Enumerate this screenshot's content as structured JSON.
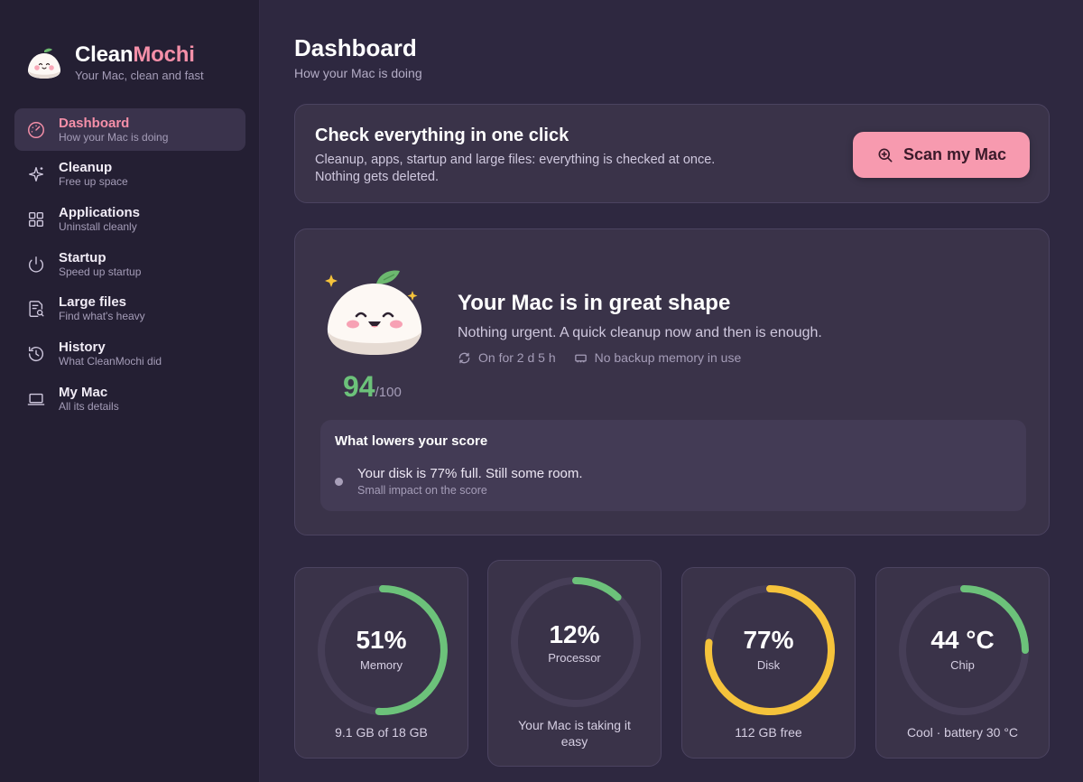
{
  "brand": {
    "name_part1": "Clean",
    "name_part2": "Mochi",
    "tagline": "Your Mac, clean and fast"
  },
  "nav": [
    {
      "label": "Dashboard",
      "sub": "How your Mac is doing",
      "icon": "gauge-icon",
      "active": true
    },
    {
      "label": "Cleanup",
      "sub": "Free up space",
      "icon": "sparkle-icon"
    },
    {
      "label": "Applications",
      "sub": "Uninstall cleanly",
      "icon": "grid-icon"
    },
    {
      "label": "Startup",
      "sub": "Speed up startup",
      "icon": "power-icon"
    },
    {
      "label": "Large files",
      "sub": "Find what's heavy",
      "icon": "file-search-icon"
    },
    {
      "label": "History",
      "sub": "What CleanMochi did",
      "icon": "history-icon"
    },
    {
      "label": "My Mac",
      "sub": "All its details",
      "icon": "laptop-icon"
    }
  ],
  "header": {
    "title": "Dashboard",
    "subtitle": "How your Mac is doing"
  },
  "scan": {
    "title": "Check everything in one click",
    "desc_line1": "Cleanup, apps, startup and large files: everything is checked at once.",
    "desc_line2": "Nothing gets deleted.",
    "button": "Scan my Mac"
  },
  "health": {
    "score": "94",
    "score_max": "/100",
    "title": "Your Mac is in great shape",
    "desc": "Nothing urgent. A quick cleanup now and then is enough.",
    "uptime": "On for 2 d 5 h",
    "swap": "No backup memory in use",
    "lowers_title": "What lowers your score",
    "lowers_item": "Your disk is 77% full. Still some room.",
    "lowers_item_sub": "Small impact on the score"
  },
  "gauges": [
    {
      "value": "51%",
      "name": "Memory",
      "foot": "9.1 GB of 18 GB",
      "fraction": 0.51,
      "color": "#6cc27a"
    },
    {
      "value": "12%",
      "name": "Processor",
      "foot": "Your Mac is taking it easy",
      "fraction": 0.12,
      "color": "#6cc27a"
    },
    {
      "value": "77%",
      "name": "Disk",
      "foot": "112 GB free",
      "fraction": 0.77,
      "color": "#f5c33b"
    },
    {
      "value": "44 °C",
      "name": "Chip",
      "foot": "Cool · battery 30 °C",
      "fraction": 0.25,
      "color": "#6cc27a"
    }
  ],
  "colors": {
    "accent": "#f58fa8",
    "good": "#6cc27a",
    "warn": "#f5c33b"
  }
}
